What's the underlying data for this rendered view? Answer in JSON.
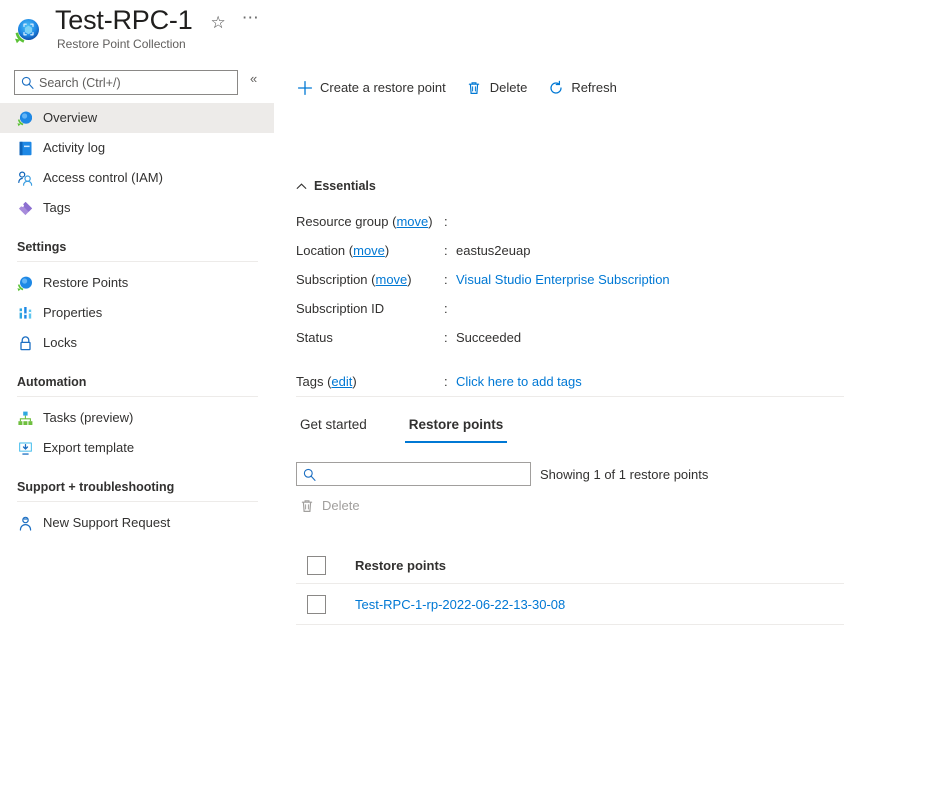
{
  "header": {
    "resource_icon": "restore-point-collection-icon",
    "title": "Test-RPC-1",
    "subtitle": "Restore Point Collection",
    "favorite_icon": "star-icon",
    "more_icon": "ellipsis-icon",
    "more_label": "⋯"
  },
  "sidebar": {
    "search": {
      "placeholder": "Search (Ctrl+/)",
      "value": "",
      "icon": "search-icon"
    },
    "collapse_icon": "chevron-double-left-icon",
    "collapse_label": "«",
    "items": [
      {
        "label": "Overview",
        "icon": "restore-point-collection-icon",
        "selected": true
      },
      {
        "label": "Activity log",
        "icon": "activity-log-icon",
        "selected": false
      },
      {
        "label": "Access control (IAM)",
        "icon": "access-control-icon",
        "selected": false
      },
      {
        "label": "Tags",
        "icon": "tags-icon",
        "selected": false
      }
    ],
    "groups": [
      {
        "title": "Settings",
        "items": [
          {
            "label": "Restore Points",
            "icon": "restore-points-icon"
          },
          {
            "label": "Properties",
            "icon": "properties-icon"
          },
          {
            "label": "Locks",
            "icon": "lock-icon"
          }
        ]
      },
      {
        "title": "Automation",
        "items": [
          {
            "label": "Tasks (preview)",
            "icon": "tasks-icon"
          },
          {
            "label": "Export template",
            "icon": "export-template-icon"
          }
        ]
      },
      {
        "title": "Support + troubleshooting",
        "items": [
          {
            "label": "New Support Request",
            "icon": "support-request-icon"
          }
        ]
      }
    ]
  },
  "main": {
    "commands": [
      {
        "label": "Create a restore point",
        "icon": "plus-icon",
        "disabled": false
      },
      {
        "label": "Delete",
        "icon": "trash-icon",
        "disabled": false
      },
      {
        "label": "Refresh",
        "icon": "refresh-icon",
        "disabled": false
      }
    ],
    "essentials": {
      "title": "Essentials",
      "collapse_icon": "chevron-up-icon",
      "rows": [
        {
          "label": "Resource group",
          "link": "move",
          "separator": ":",
          "value": "",
          "is_link": false
        },
        {
          "label": "Location",
          "link": "move",
          "separator": ":",
          "value": "eastus2euap",
          "is_link": false
        },
        {
          "label": "Subscription",
          "link": "move",
          "separator": ":",
          "value": "Visual Studio Enterprise Subscription",
          "is_link": true
        },
        {
          "label": "Subscription ID",
          "link": "",
          "separator": ":",
          "value": "",
          "is_link": false
        },
        {
          "label": "Status",
          "link": "",
          "separator": ":",
          "value": "Succeeded",
          "is_link": false
        }
      ],
      "tags": {
        "label": "Tags",
        "link": "edit",
        "separator": ":",
        "value": "Click here to add tags"
      }
    },
    "tabs": [
      {
        "label": "Get started",
        "active": false
      },
      {
        "label": "Restore points",
        "active": true
      }
    ],
    "filter": {
      "placeholder": "",
      "value": "",
      "icon": "search-icon",
      "showing_text": "Showing 1 of 1 restore points"
    },
    "tab_commands": [
      {
        "label": "Delete",
        "icon": "trash-icon",
        "disabled": true
      }
    ],
    "table": {
      "select_all_checkbox": false,
      "columns": [
        "Restore points"
      ],
      "rows": [
        {
          "checked": false,
          "name": "Test-RPC-1-rp-2022-06-22-13-30-08"
        }
      ]
    }
  },
  "colors": {
    "accent": "#0078d4",
    "link": "#0078d4",
    "text": "#323130",
    "muted": "#605e5c",
    "selected_row": "#edebe9",
    "border": "#edebe9"
  }
}
